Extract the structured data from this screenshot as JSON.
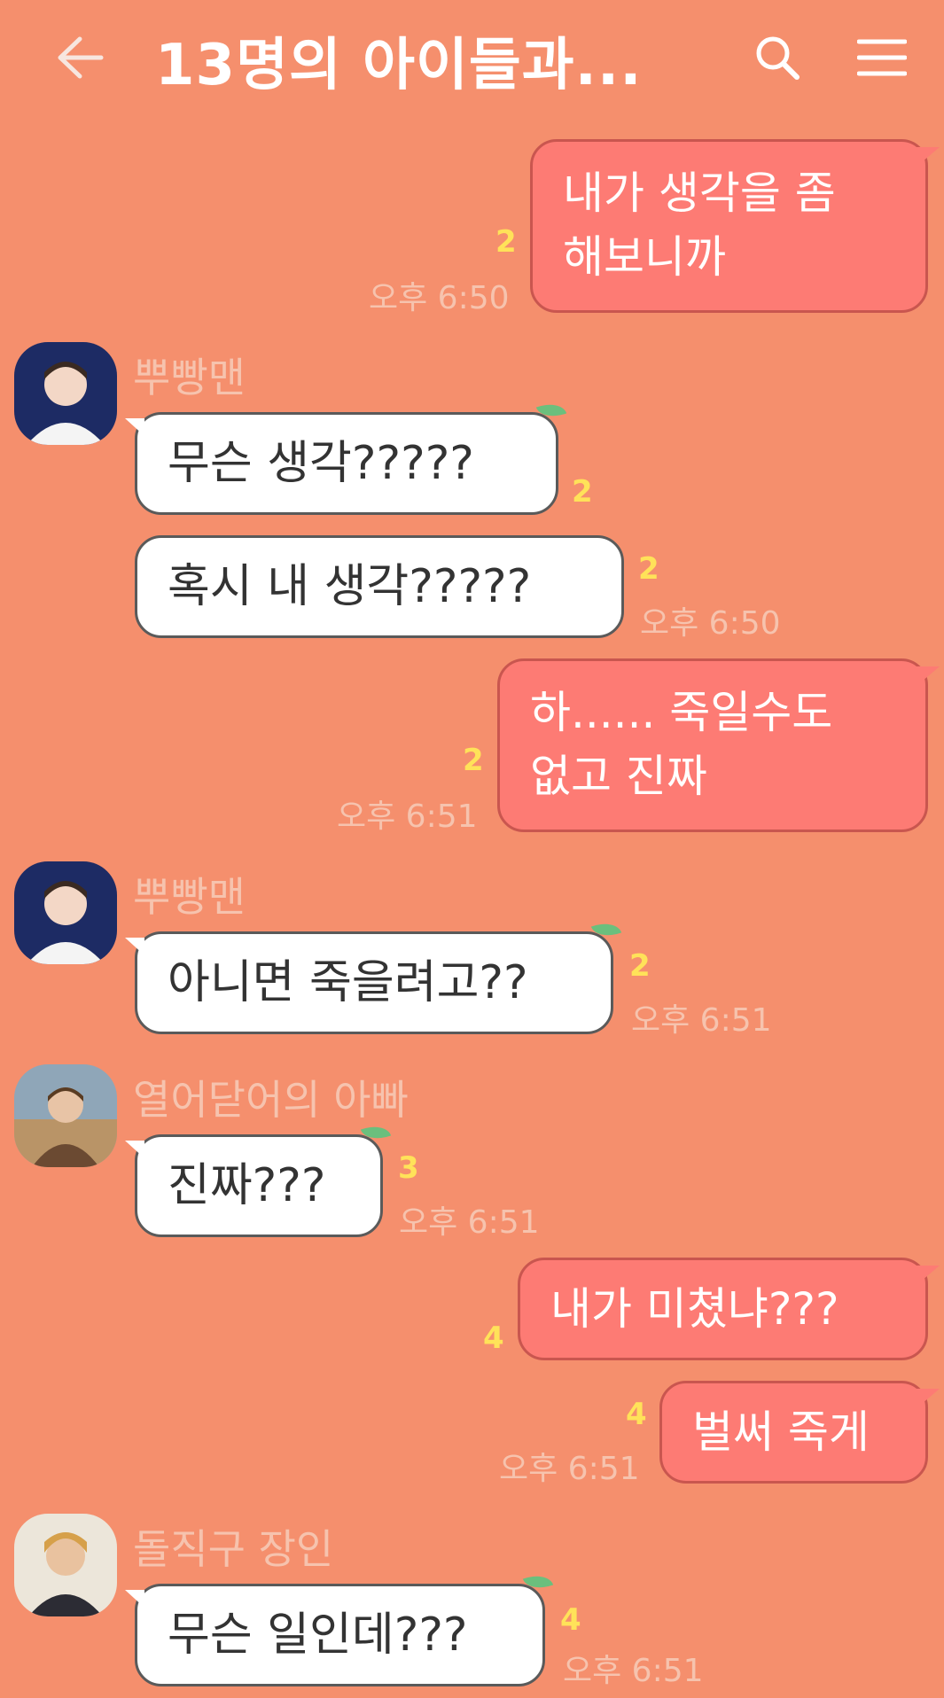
{
  "header": {
    "title": "13명의 아이들과...",
    "back_icon": "arrow-left-icon",
    "search_icon": "search-icon",
    "menu_icon": "hamburger-menu-icon"
  },
  "colors": {
    "background": "#f58f6d",
    "outgoing_bubble": "#fd7b74",
    "incoming_bubble": "#ffffff",
    "unread_count": "#ffe259",
    "meta_text": "#f6c3ae"
  },
  "messages": [
    {
      "direction": "out",
      "line1": "내가 생각을 좀",
      "line2": "해보니까",
      "unread": "2",
      "time": "오후 6:50"
    },
    {
      "direction": "in",
      "sender": "뿌빵맨",
      "text": "무슨 생각?????",
      "unread": "2"
    },
    {
      "direction": "in",
      "text": "혹시 내 생각?????",
      "unread": "2",
      "time": "오후 6:50"
    },
    {
      "direction": "out",
      "line1": "하...... 죽일수도",
      "line2": "없고 진짜",
      "unread": "2",
      "time": "오후 6:51"
    },
    {
      "direction": "in",
      "sender": "뿌빵맨",
      "text": "아니면 죽을려고??",
      "unread": "2",
      "time": "오후 6:51"
    },
    {
      "direction": "in",
      "sender": "열어닫어의 아빠",
      "text": "진짜???",
      "unread": "3",
      "time": "오후 6:51"
    },
    {
      "direction": "out",
      "text": "내가 미쳤냐???",
      "unread": "4"
    },
    {
      "direction": "out",
      "text": "벌써 죽게",
      "unread": "4",
      "time": "오후 6:51"
    },
    {
      "direction": "in",
      "sender": "돌직구 장인",
      "text": "무슨 일인데???",
      "unread": "4",
      "time": "오후 6:51"
    }
  ]
}
